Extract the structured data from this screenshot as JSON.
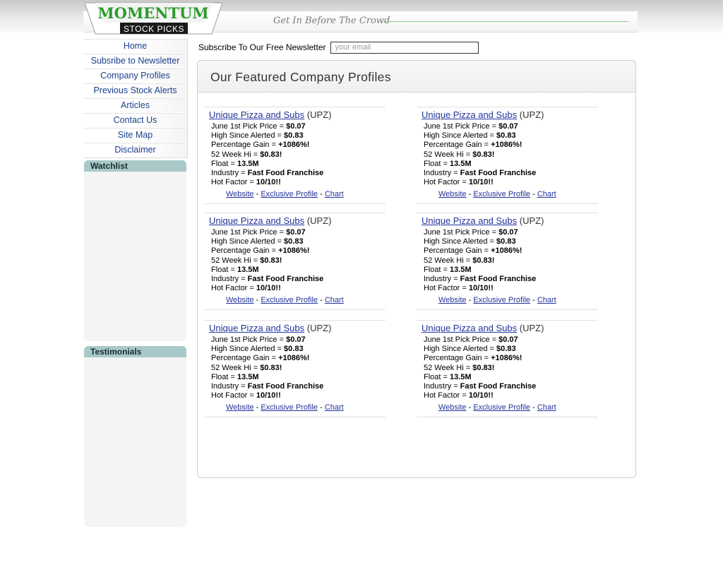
{
  "logo": {
    "word": "MOMENTUM",
    "sub": "STOCK PICKS"
  },
  "tagline": "Get In Before The Crowd",
  "nav": [
    "Home",
    "Subsribe to Newsletter",
    "Company Profiles",
    "Previous Stock Alerts",
    "Articles",
    "Contact Us",
    "Site Map",
    "Disclaimer"
  ],
  "sidebar": {
    "watchlist_title": "Watchlist",
    "testimonials_title": "Testimonials"
  },
  "newsletter": {
    "label": "Subscribe To Our Free Newsletter",
    "placeholder": "your email"
  },
  "main": {
    "title": "Our Featured Company Profiles"
  },
  "profiles": [
    {
      "name": "Unique Pizza and Subs",
      "ticker": "(UPZ)",
      "pick_label": "June 1st Pick Price = ",
      "pick_value": "$0.07",
      "high_label": "High Since Alerted = ",
      "high_value": "$0.83",
      "gain_label": "Percentage Gain = ",
      "gain_value": "+1086%!",
      "week_label": "52 Week Hi = ",
      "week_value": "$0.83!",
      "float_label": "Float = ",
      "float_value": "13.5M",
      "industry_label": "Industry = ",
      "industry_value": "Fast Food Franchise",
      "hot_label": "Hot Factor = ",
      "hot_value": "10/10!!",
      "link_website": "Website",
      "link_profile": "Exclusive Profile",
      "link_chart": "Chart"
    },
    {
      "name": "Unique Pizza and Subs",
      "ticker": "(UPZ)",
      "pick_label": "June 1st Pick Price = ",
      "pick_value": "$0.07",
      "high_label": "High Since Alerted = ",
      "high_value": "$0.83",
      "gain_label": "Percentage Gain = ",
      "gain_value": "+1086%!",
      "week_label": "52 Week Hi = ",
      "week_value": "$0.83!",
      "float_label": "Float = ",
      "float_value": "13.5M",
      "industry_label": "Industry = ",
      "industry_value": "Fast Food Franchise",
      "hot_label": "Hot Factor = ",
      "hot_value": "10/10!!",
      "link_website": "Website",
      "link_profile": "Exclusive Profile",
      "link_chart": "Chart"
    },
    {
      "name": "Unique Pizza and Subs",
      "ticker": "(UPZ)",
      "pick_label": "June 1st Pick Price = ",
      "pick_value": "$0.07",
      "high_label": "High Since Alerted = ",
      "high_value": "$0.83",
      "gain_label": "Percentage Gain = ",
      "gain_value": "+1086%!",
      "week_label": "52 Week Hi = ",
      "week_value": "$0.83!",
      "float_label": "Float = ",
      "float_value": "13.5M",
      "industry_label": "Industry = ",
      "industry_value": "Fast Food Franchise",
      "hot_label": "Hot Factor = ",
      "hot_value": "10/10!!",
      "link_website": "Website",
      "link_profile": "Exclusive Profile",
      "link_chart": "Chart"
    },
    {
      "name": "Unique Pizza and Subs",
      "ticker": "(UPZ)",
      "pick_label": "June 1st Pick Price = ",
      "pick_value": "$0.07",
      "high_label": "High Since Alerted = ",
      "high_value": "$0.83",
      "gain_label": "Percentage Gain = ",
      "gain_value": "+1086%!",
      "week_label": "52 Week Hi = ",
      "week_value": "$0.83!",
      "float_label": "Float = ",
      "float_value": "13.5M",
      "industry_label": "Industry = ",
      "industry_value": "Fast Food Franchise",
      "hot_label": "Hot Factor = ",
      "hot_value": "10/10!!",
      "link_website": "Website",
      "link_profile": "Exclusive Profile",
      "link_chart": "Chart"
    },
    {
      "name": "Unique Pizza and Subs",
      "ticker": "(UPZ)",
      "pick_label": "June 1st Pick Price = ",
      "pick_value": "$0.07",
      "high_label": "High Since Alerted = ",
      "high_value": "$0.83",
      "gain_label": "Percentage Gain = ",
      "gain_value": "+1086%!",
      "week_label": "52 Week Hi = ",
      "week_value": "$0.83!",
      "float_label": "Float = ",
      "float_value": "13.5M",
      "industry_label": "Industry = ",
      "industry_value": "Fast Food Franchise",
      "hot_label": "Hot Factor = ",
      "hot_value": "10/10!!",
      "link_website": "Website",
      "link_profile": "Exclusive Profile",
      "link_chart": "Chart"
    },
    {
      "name": "Unique Pizza and Subs",
      "ticker": "(UPZ)",
      "pick_label": "June 1st Pick Price = ",
      "pick_value": "$0.07",
      "high_label": "High Since Alerted = ",
      "high_value": "$0.83",
      "gain_label": "Percentage Gain = ",
      "gain_value": "+1086%!",
      "week_label": "52 Week Hi = ",
      "week_value": "$0.83!",
      "float_label": "Float = ",
      "float_value": "13.5M",
      "industry_label": "Industry = ",
      "industry_value": "Fast Food Franchise",
      "hot_label": "Hot Factor = ",
      "hot_value": "10/10!!",
      "link_website": "Website",
      "link_profile": "Exclusive Profile",
      "link_chart": "Chart"
    }
  ],
  "colors": {
    "link": "#23339a",
    "nav_link": "#1a3f8c",
    "logo_green": "#2e9a2e",
    "box_header": "#a9c9c9"
  }
}
